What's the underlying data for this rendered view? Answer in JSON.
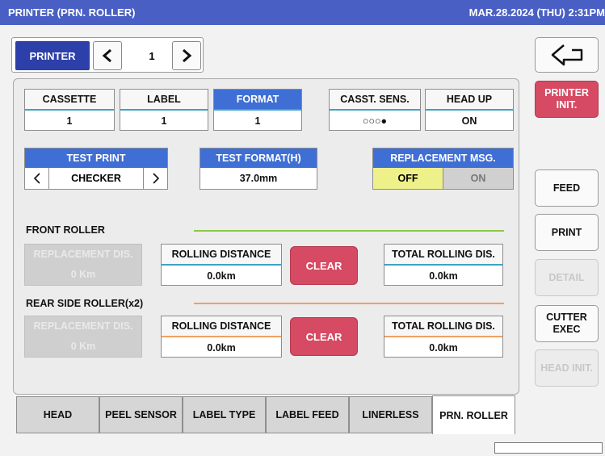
{
  "window": {
    "title": "PRINTER (PRN. ROLLER)",
    "datetime": "MAR.28.2024 (THU)  2:31PM"
  },
  "nav": {
    "label": "PRINTER",
    "number": "1",
    "prev_icon": "chevron-left-icon",
    "next_icon": "chevron-right-icon"
  },
  "back": {
    "icon": "return-arrow-icon"
  },
  "top_fields": {
    "cassette": {
      "label": "CASSETTE",
      "value": "1"
    },
    "label": {
      "label": "LABEL",
      "value": "1"
    },
    "format": {
      "label": "FORMAT",
      "value": "1"
    },
    "casst_sens": {
      "label": "CASST. SENS.",
      "value": "○○○●"
    },
    "head_up": {
      "label": "HEAD UP",
      "value": "ON"
    }
  },
  "test_print": {
    "label": "TEST PRINT",
    "value": "CHECKER"
  },
  "test_format": {
    "label": "TEST FORMAT(H)",
    "value": "37.0mm"
  },
  "replacement_msg": {
    "label": "REPLACEMENT MSG.",
    "off": "OFF",
    "on": "ON",
    "selected": "OFF"
  },
  "front_roller": {
    "title": "FRONT ROLLER",
    "replacement_dis": {
      "label": "REPLACEMENT DIS.",
      "value": "0 Km"
    },
    "rolling_distance": {
      "label": "ROLLING DISTANCE",
      "value": "0.0km"
    },
    "clear_label": "CLEAR",
    "total_rolling": {
      "label": "TOTAL ROLLING DIS.",
      "value": "0.0km"
    }
  },
  "rear_roller": {
    "title": "REAR SIDE ROLLER(x2)",
    "replacement_dis": {
      "label": "REPLACEMENT DIS.",
      "value": "0 Km"
    },
    "rolling_distance": {
      "label": "ROLLING DISTANCE",
      "value": "0.0km"
    },
    "clear_label": "CLEAR",
    "total_rolling": {
      "label": "TOTAL ROLLING DIS.",
      "value": "0.0km"
    }
  },
  "side_buttons": {
    "printer_init": "PRINTER INIT.",
    "feed": "FEED",
    "print": "PRINT",
    "detail": "DETAIL",
    "cutter_exec": "CUTTER EXEC",
    "head_init": "HEAD INIT."
  },
  "tabs": [
    {
      "label": "HEAD"
    },
    {
      "label": "PEEL SENSOR"
    },
    {
      "label": "LABEL TYPE"
    },
    {
      "label": "LABEL FEED"
    },
    {
      "label": "LINERLESS"
    },
    {
      "label": "PRN. ROLLER"
    }
  ],
  "active_tab": "PRN. ROLLER",
  "colors": {
    "accent_blue": "#4a5fc4",
    "nav_blue": "#2d3fa8",
    "red": "#d64a63",
    "toggle_yellow": "#eef08a"
  }
}
